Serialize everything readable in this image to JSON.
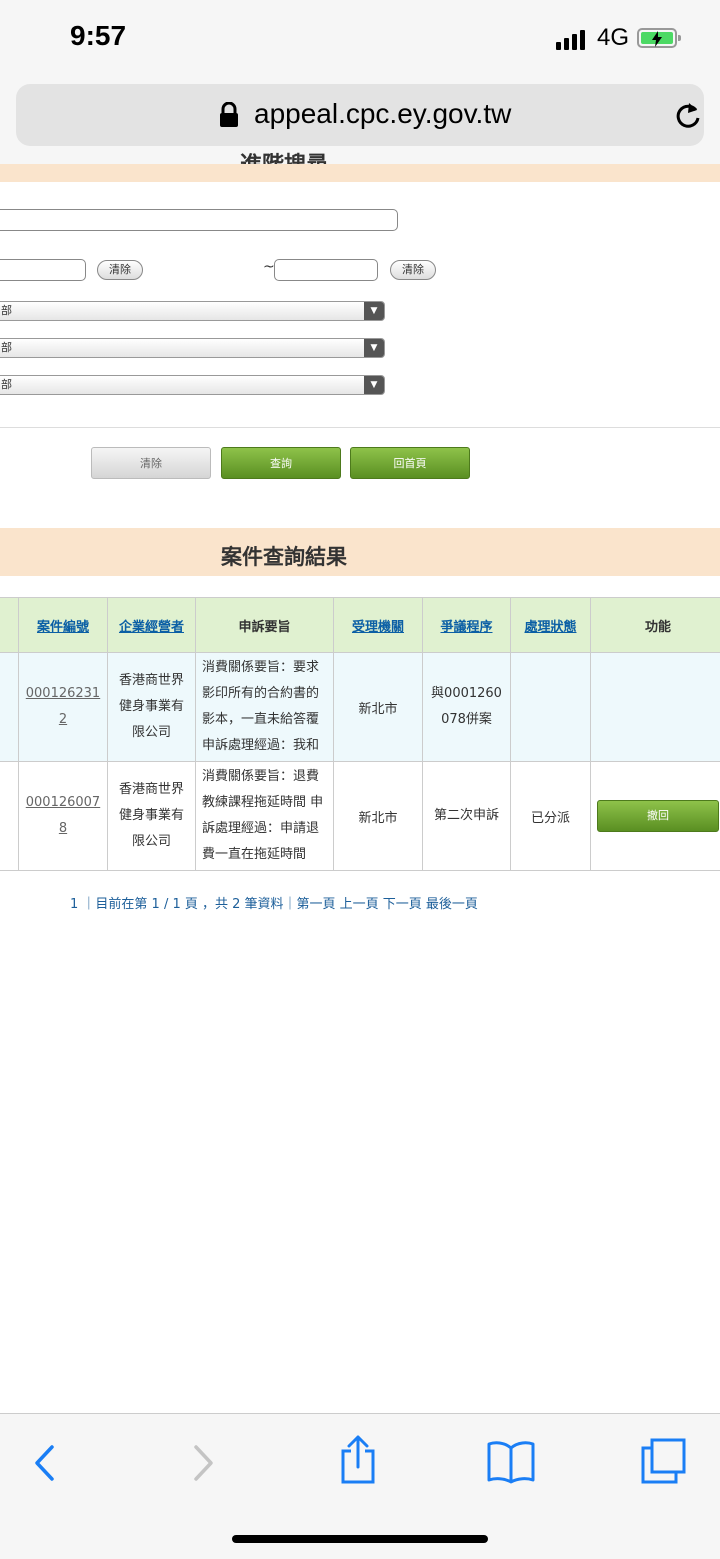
{
  "status_bar": {
    "time": "9:57",
    "network": "4G"
  },
  "browser": {
    "url": "appeal.cpc.ey.gov.tw"
  },
  "search_form": {
    "section_title": "進階搜尋",
    "clear_label": "清除",
    "tilde": "~",
    "selects": [
      {
        "value": "部"
      },
      {
        "value": "部"
      },
      {
        "value": "部"
      }
    ],
    "buttons": {
      "clear": "清除",
      "query": "查詢",
      "home": "回首頁"
    }
  },
  "results": {
    "title": "案件查詢結果",
    "columns": [
      "案件編號",
      "企業經營者",
      "申訴要旨",
      "受理機關",
      "爭議程序",
      "處理狀態",
      "功能"
    ],
    "rows": [
      {
        "case_no_1": "000126231",
        "case_no_2": "2",
        "company": "香港商世界健身事業有限公司",
        "summary": "消費關係要旨：要求影印所有的合約書的影本，一直未給答覆申訴處理經過：我和",
        "agency": "新北市",
        "procedure": "與0001260078併案",
        "status": "",
        "action": ""
      },
      {
        "case_no_1": "000126007",
        "case_no_2": "8",
        "company": "香港商世界健身事業有限公司",
        "summary": "消費關係要旨：退費教練課程拖延時間 申訴處理經過：申請退費一直在拖延時間",
        "agency": "新北市",
        "procedure": "第二次申訴",
        "status": "已分派",
        "action": "撤回"
      }
    ],
    "pager": "1 ｜目前在第 1 / 1 頁 ，共 2 筆資料｜第一頁 上一頁 下一頁 最後一頁"
  }
}
